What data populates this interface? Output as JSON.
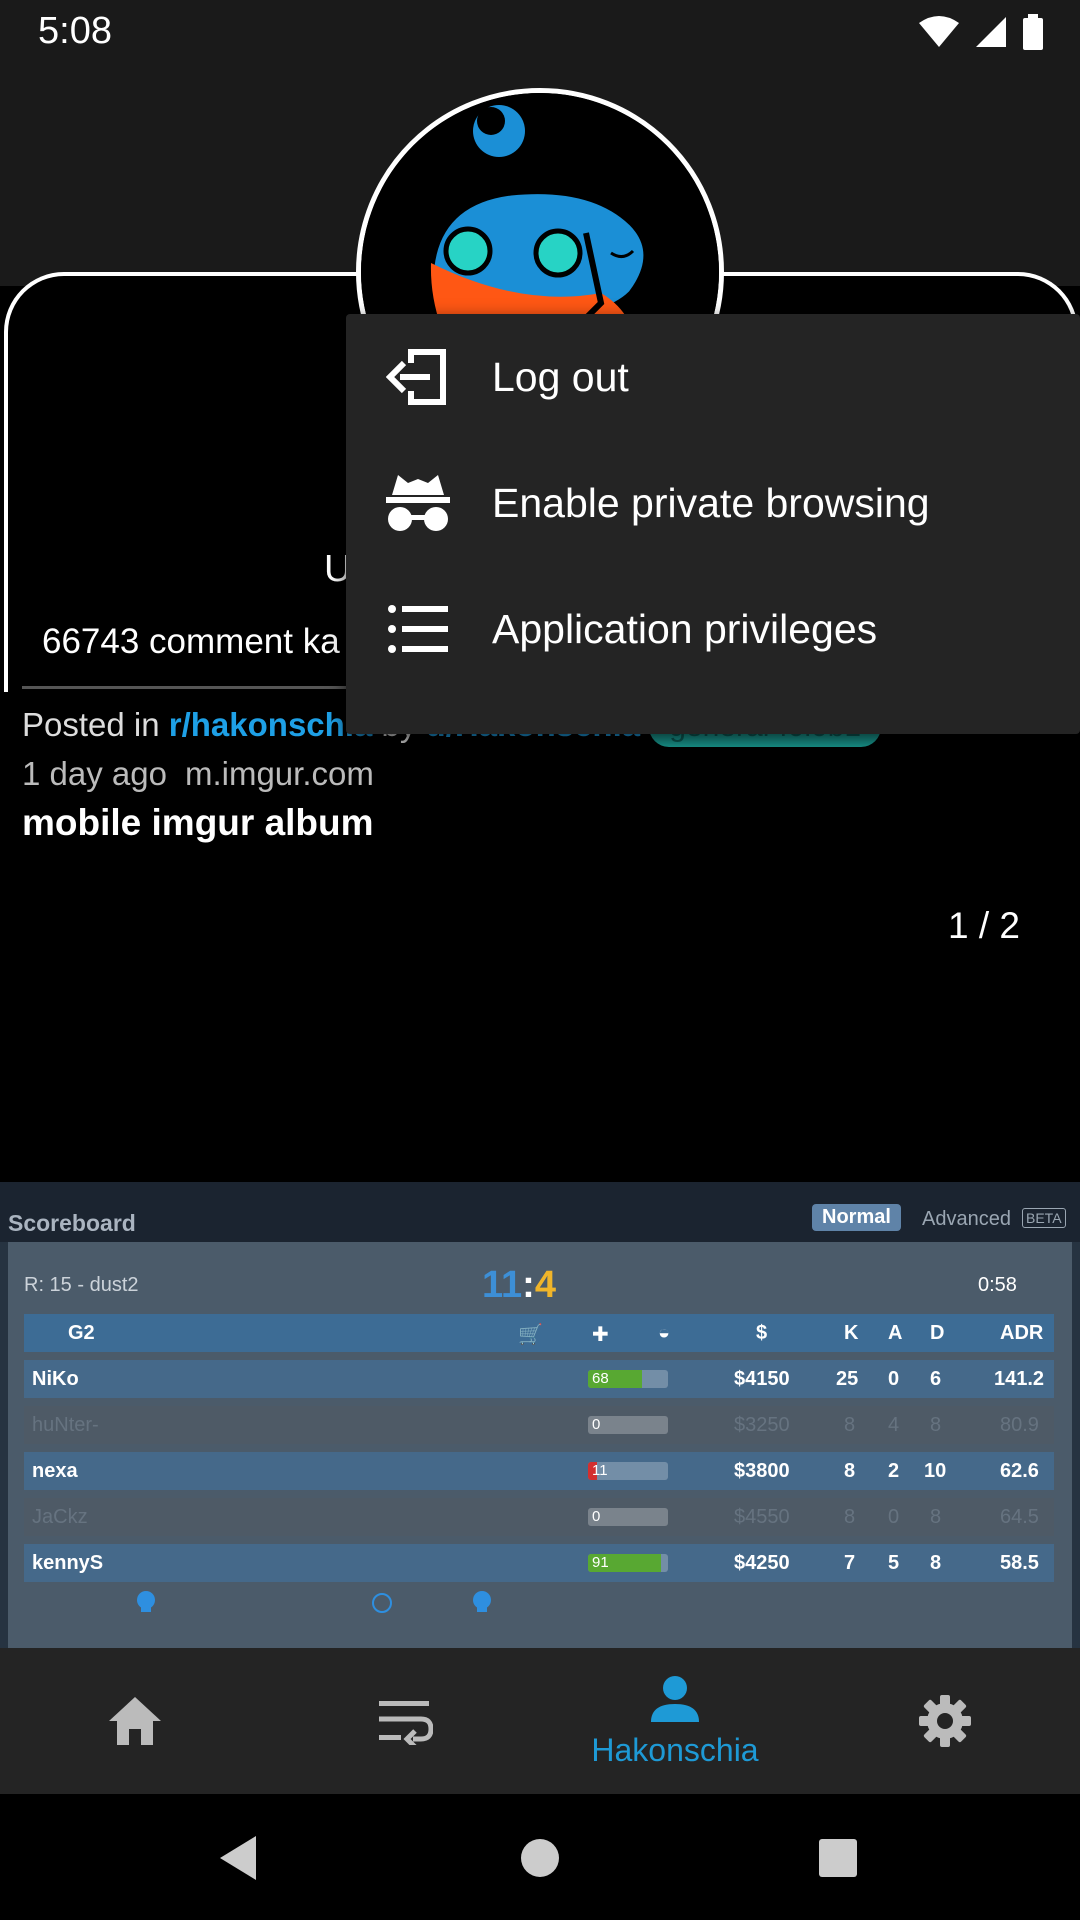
{
  "status_bar": {
    "time": "5:08"
  },
  "profile": {
    "name_partial": "U",
    "karma_partial": "66743 comment ka"
  },
  "post": {
    "posted_in_prefix": "Posted in",
    "subreddit": "r/hakonschia",
    "by": "by",
    "author": "u/Hakonschia",
    "flair": "general-f0l0b1",
    "time": "1 day ago",
    "domain": "m.imgur.com",
    "title": "mobile imgur album",
    "album_counter": "1 / 2"
  },
  "scoreboard": {
    "title": "Scoreboard",
    "tab_normal": "Normal",
    "tab_advanced": "Advanced",
    "beta": "BETA",
    "round": "R: 15 - dust2",
    "score_ct": "11",
    "score_sep": ":",
    "score_t": "4",
    "clock": "0:58",
    "team": "G2",
    "headers": {
      "money": "$",
      "k": "K",
      "a": "A",
      "d": "D",
      "adr": "ADR"
    },
    "players": [
      {
        "name": "NiKo",
        "hp": "68",
        "money": "$4150",
        "k": "25",
        "a": "0",
        "d": "6",
        "adr": "141.2",
        "alive": true
      },
      {
        "name": "huNter-",
        "hp": "0",
        "money": "$3250",
        "k": "8",
        "a": "4",
        "d": "8",
        "adr": "80.9",
        "alive": false
      },
      {
        "name": "nexa",
        "hp": "11",
        "money": "$3800",
        "k": "8",
        "a": "2",
        "d": "10",
        "adr": "62.6",
        "alive": true
      },
      {
        "name": "JaCkz",
        "hp": "0",
        "money": "$4550",
        "k": "8",
        "a": "0",
        "d": "8",
        "adr": "64.5",
        "alive": false
      },
      {
        "name": "kennyS",
        "hp": "91",
        "money": "$4250",
        "k": "7",
        "a": "5",
        "d": "8",
        "adr": "58.5",
        "alive": true
      }
    ]
  },
  "bottom_nav": {
    "items": [
      {
        "icon": "home-icon"
      },
      {
        "icon": "subreddits-icon"
      },
      {
        "icon": "profile-icon",
        "label": "Hakonschia",
        "active": true
      },
      {
        "icon": "settings-icon"
      }
    ]
  },
  "menu": {
    "items": [
      {
        "icon": "logout-icon",
        "label": "Log out"
      },
      {
        "icon": "incognito-icon",
        "label": "Enable private browsing"
      },
      {
        "icon": "list-icon",
        "label": "Application privileges"
      }
    ]
  },
  "colors": {
    "accent": "#1e9ad6",
    "flair": "#1a9e95",
    "menu_bg": "#242424",
    "nav_bg": "#242424"
  }
}
